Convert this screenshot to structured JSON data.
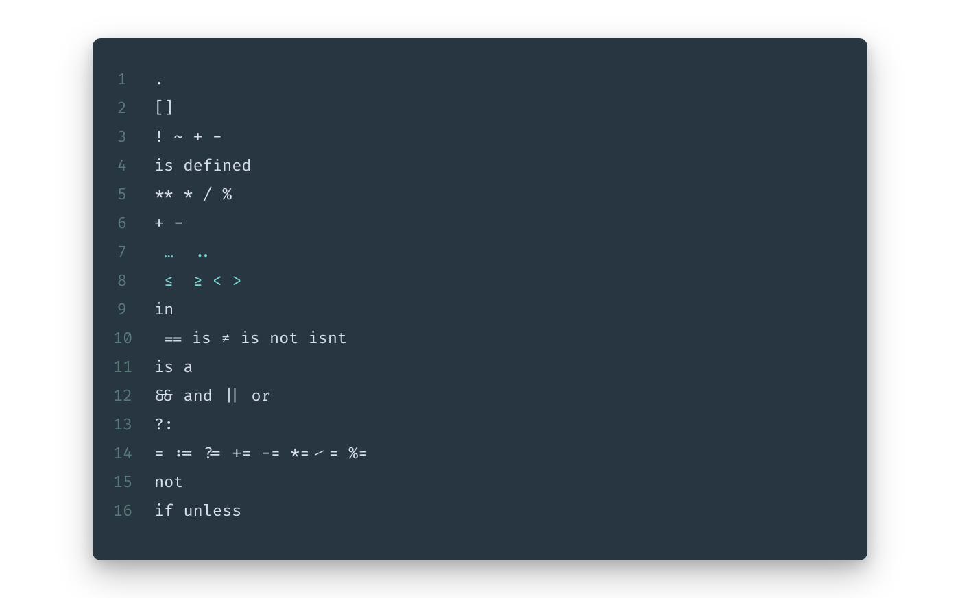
{
  "code": {
    "lines": [
      {
        "num": "1",
        "content": "."
      },
      {
        "num": "2",
        "content": "[]"
      },
      {
        "num": "3",
        "content": "! ~ + -"
      },
      {
        "num": "4",
        "content": "is defined"
      },
      {
        "num": "5",
        "content": "** * / %"
      },
      {
        "num": "6",
        "content": "+ -"
      },
      {
        "num": "7",
        "content": " …  .."
      },
      {
        "num": "8",
        "content": " ≤  ≥ < >"
      },
      {
        "num": "9",
        "content": "in"
      },
      {
        "num": "10",
        "content": " ⩵ is ≠ is not isnt"
      },
      {
        "num": "11",
        "content": "is a"
      },
      {
        "num": "12",
        "content": "&& and || or"
      },
      {
        "num": "13",
        "content": "?:"
      },
      {
        "num": "14",
        "content": "= := ?= += -= *= ⁄= %="
      },
      {
        "num": "15",
        "content": "not"
      },
      {
        "num": "16",
        "content": "if unless"
      }
    ]
  }
}
